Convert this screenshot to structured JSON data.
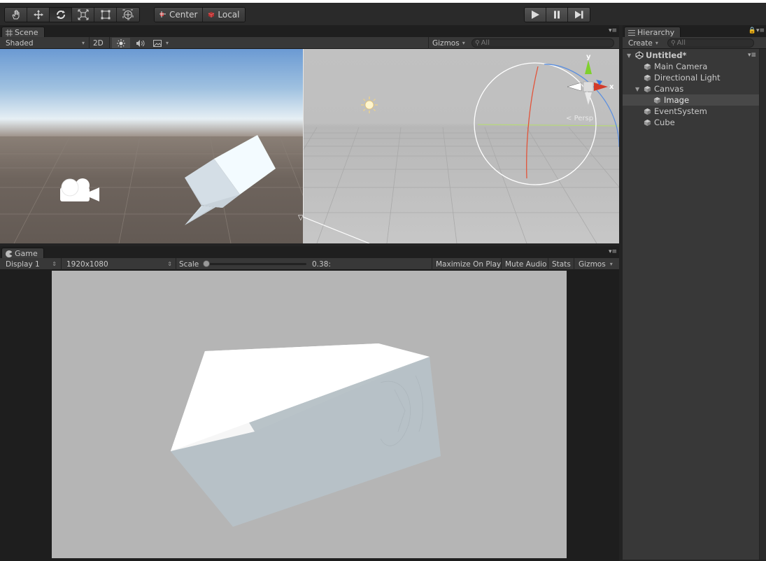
{
  "toolbar": {
    "transform_tools": [
      {
        "name": "hand-tool",
        "icon": "hand-icon",
        "active": false
      },
      {
        "name": "move-tool",
        "icon": "move-arrows-icon",
        "active": false
      },
      {
        "name": "rotate-tool",
        "icon": "rotate-icon",
        "active": true
      },
      {
        "name": "scale-tool",
        "icon": "scale-icon",
        "active": false
      },
      {
        "name": "rect-tool",
        "icon": "rect-icon",
        "active": false
      },
      {
        "name": "transform-tool",
        "icon": "transform-icon",
        "active": false
      }
    ],
    "pivot_mode": "Center",
    "pivot_rotation": "Local",
    "play_icon": "play-icon",
    "pause_icon": "pause-icon",
    "step_icon": "step-icon"
  },
  "scene": {
    "tab_label": "Scene",
    "shading_mode": "Shaded",
    "mode_2d": "2D",
    "gizmos_label": "Gizmos",
    "search_placeholder": "All",
    "persp_label": "Persp",
    "axis_x": "x",
    "axis_y": "y"
  },
  "game": {
    "tab_label": "Game",
    "display": "Display 1",
    "resolution": "1920x1080",
    "scale_label": "Scale",
    "scale_value": "0.38:",
    "scale_fraction": 0.0,
    "maximize_label": "Maximize On Play",
    "mute_label": "Mute Audio",
    "stats_label": "Stats",
    "gizmos_label": "Gizmos"
  },
  "hierarchy": {
    "tab_label": "Hierarchy",
    "create_label": "Create",
    "search_placeholder": "All",
    "scene_name": "Untitled*",
    "items": [
      {
        "label": "Main Camera",
        "depth": 1,
        "has_children": false,
        "selected": false
      },
      {
        "label": "Directional Light",
        "depth": 1,
        "has_children": false,
        "selected": false
      },
      {
        "label": "Canvas",
        "depth": 1,
        "has_children": true,
        "selected": false
      },
      {
        "label": "Image",
        "depth": 2,
        "has_children": false,
        "selected": true
      },
      {
        "label": "EventSystem",
        "depth": 1,
        "has_children": false,
        "selected": false
      },
      {
        "label": "Cube",
        "depth": 1,
        "has_children": false,
        "selected": false
      }
    ]
  },
  "colors": {
    "axis_x": "#d33b2a",
    "axis_y": "#7fd02d",
    "axis_z": "#3d7ae0",
    "panel_bg": "#383838",
    "selected_row": "#484848"
  }
}
